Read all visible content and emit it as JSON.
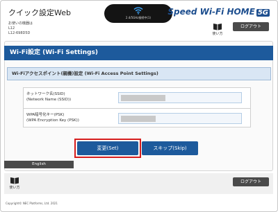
{
  "header": {
    "app_title": "クイック設定Web",
    "device_label": "お使いの機器は",
    "device_model": "L12",
    "device_serial": "L12-698D5D",
    "router_status": "2.4/5GHz接続中(1)",
    "brand_text": "Speed Wi-Fi HOME",
    "brand_badge": "5G",
    "manual_label": "使い方",
    "logout_label": "ログアウト"
  },
  "section": {
    "title": "Wi-Fi設定 (Wi-Fi Settings)",
    "subtitle": "Wi-Fiアクセスポイント(親機)設定 (Wi-Fi Access Point Settings)"
  },
  "form": {
    "ssid_label_ja": "ネットワーク名(SSID)",
    "ssid_label_en": "(Network Name (SSID))",
    "psk_label_ja": "WPA暗号化キー(PSK)",
    "psk_label_en": "(WPA Encryption Key (PSK))"
  },
  "actions": {
    "set_label": "変更(Set)",
    "skip_label": "スキップ(Skip)",
    "english_label": "English"
  },
  "footer": {
    "manual_label": "使い方",
    "logout_label": "ログアウト",
    "copyright": "Copyright© NEC Platforms, Ltd. 2021"
  },
  "icons": {
    "wifi": "wifi-icon",
    "manual": "book-icon"
  },
  "colors": {
    "primary": "#1d5a9c",
    "highlight": "#d61c1c",
    "dark_button": "#4a4a4a"
  }
}
